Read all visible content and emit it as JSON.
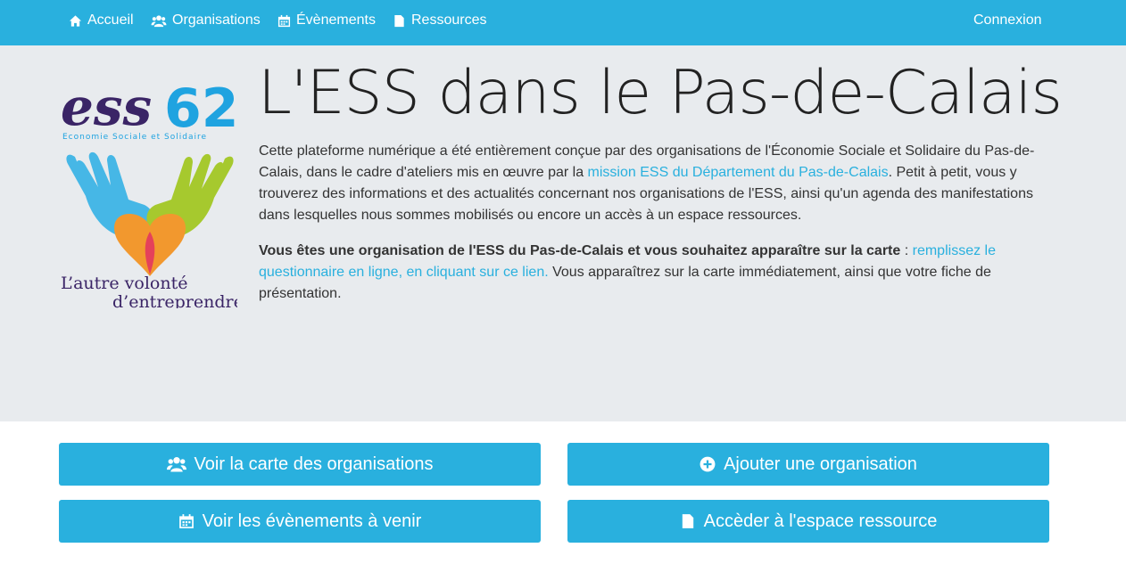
{
  "nav": {
    "home": "Accueil",
    "organisations": "Organisations",
    "events": "Évènements",
    "resources": "Ressources",
    "login": "Connexion"
  },
  "logo": {
    "brand": "ess",
    "number": "62",
    "subtitle": "Economie Sociale et Solidaire",
    "slogan_line1": "L’autre volonté",
    "slogan_line2": "d’entreprendre"
  },
  "hero": {
    "title": "L'ESS dans le Pas-de-Calais",
    "intro_before": "Cette plateforme numérique a été entièrement conçue par des organisations de l'Économie Sociale et Solidaire du Pas-de-Calais, dans le cadre d'ateliers mis en œuvre par la ",
    "intro_link": "mission ESS du Département du Pas-de-Calais",
    "intro_after": ". Petit à petit, vous y trouverez des informations et des actualités concernant nos organisations de l'ESS, ainsi qu'un agenda des manifestations dans lesquelles nous sommes mobilisés ou encore un accès à un espace ressources.",
    "cta_bold": "Vous êtes une organisation de l'ESS du Pas-de-Calais et vous souhaitez apparaître sur la carte",
    "cta_sep": " : ",
    "cta_link": "remplissez le questionnaire en ligne, en cliquant sur ce lien.",
    "cta_after": " Vous apparaîtrez sur la carte immédiatement, ainsi que votre fiche de présentation."
  },
  "buttons": {
    "map": "Voir la carte des organisations",
    "add": "Ajouter une organisation",
    "events": "Voir les évènements à venir",
    "resources": "Accèder à l'espace ressource"
  },
  "colors": {
    "accent": "#29b0de",
    "jumbotron": "#e8ebee",
    "logo_purple": "#3a2466",
    "logo_blue": "#1fa3e0"
  },
  "icons": {
    "home": "home-icon",
    "organisations": "users-icon",
    "events": "calendar-icon",
    "resources": "file-icon",
    "add": "plus-circle-icon"
  }
}
